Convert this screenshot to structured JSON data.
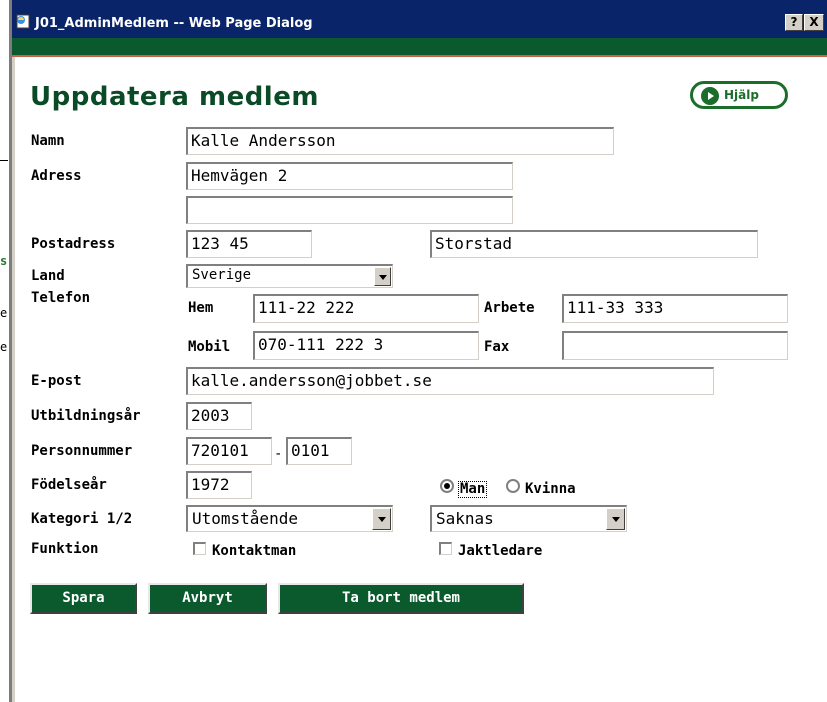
{
  "window": {
    "title": "J01_AdminMedlem -- Web Page Dialog",
    "help_glyph": "?",
    "close_glyph": "X"
  },
  "background_window": {
    "fragments": [
      "s",
      "e",
      "e"
    ]
  },
  "page": {
    "title": "Uppdatera medlem",
    "help_label": "Hjälp"
  },
  "labels": {
    "namn": "Namn",
    "adress": "Adress",
    "postadress": "Postadress",
    "land": "Land",
    "telefon": "Telefon",
    "hem": "Hem",
    "arbete": "Arbete",
    "mobil": "Mobil",
    "fax": "Fax",
    "epost": "E-post",
    "utbildningsar": "Utbildningsår",
    "personnummer": "Personnummer",
    "personnummer_sep": "-",
    "fodelsear": "Födelseår",
    "kategori": "Kategori 1/2",
    "funktion": "Funktion"
  },
  "fields": {
    "namn": "Kalle Andersson",
    "adress1": "Hemvägen 2",
    "adress2": "",
    "postnummer": "123 45",
    "ort": "Storstad",
    "land": "Sverige",
    "tel_hem": "111-22 222",
    "tel_arbete": "111-33 333",
    "tel_mobil": "070-111 222 3",
    "tel_fax": "",
    "epost": "kalle.andersson@jobbet.se",
    "utbildningsar": "2003",
    "personnummer_datum": "720101",
    "personnummer_nr": "0101",
    "fodelsear": "1972",
    "kategori1": "Utomstående",
    "kategori2": "Saknas"
  },
  "gender": {
    "man_label": "Man",
    "kvinna_label": "Kvinna",
    "selected": "Man"
  },
  "funktion": {
    "kontaktman_label": "Kontaktman",
    "kontaktman_checked": false,
    "jaktledare_label": "Jaktledare",
    "jaktledare_checked": false
  },
  "buttons": {
    "spara": "Spara",
    "avbryt": "Avbryt",
    "ta_bort": "Ta bort medlem"
  },
  "colors": {
    "titlebar": "#0a246a",
    "header_green": "#0b5a2e",
    "title_green": "#0b4a26",
    "accent_line": "#c86446"
  }
}
